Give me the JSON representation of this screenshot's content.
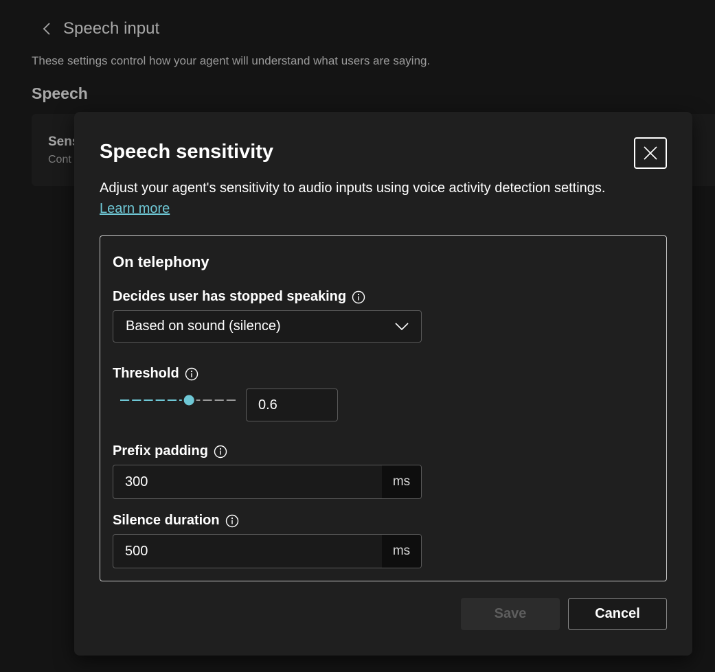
{
  "background": {
    "title": "Speech input",
    "description": "These settings control how your agent will understand what users are saying.",
    "section": "Speech",
    "card_title": "Sens",
    "card_subtitle": "Cont"
  },
  "dialog": {
    "title": "Speech sensitivity",
    "description": "Adjust your agent's sensitivity to audio inputs using voice activity detection settings.",
    "learn_more": "Learn more",
    "group_title": "On telephony",
    "stop_speaking": {
      "label": "Decides user has stopped speaking",
      "value": "Based on sound (silence)"
    },
    "threshold": {
      "label": "Threshold",
      "value": "0.6",
      "level": 0.6
    },
    "prefix_padding": {
      "label": "Prefix padding",
      "value": "300",
      "unit": "ms"
    },
    "silence_duration": {
      "label": "Silence duration",
      "value": "500",
      "unit": "ms"
    },
    "save_label": "Save",
    "cancel_label": "Cancel"
  },
  "colors": {
    "accent": "#6fc8d6",
    "background": "#141414",
    "dialog": "#1f1f1f"
  }
}
